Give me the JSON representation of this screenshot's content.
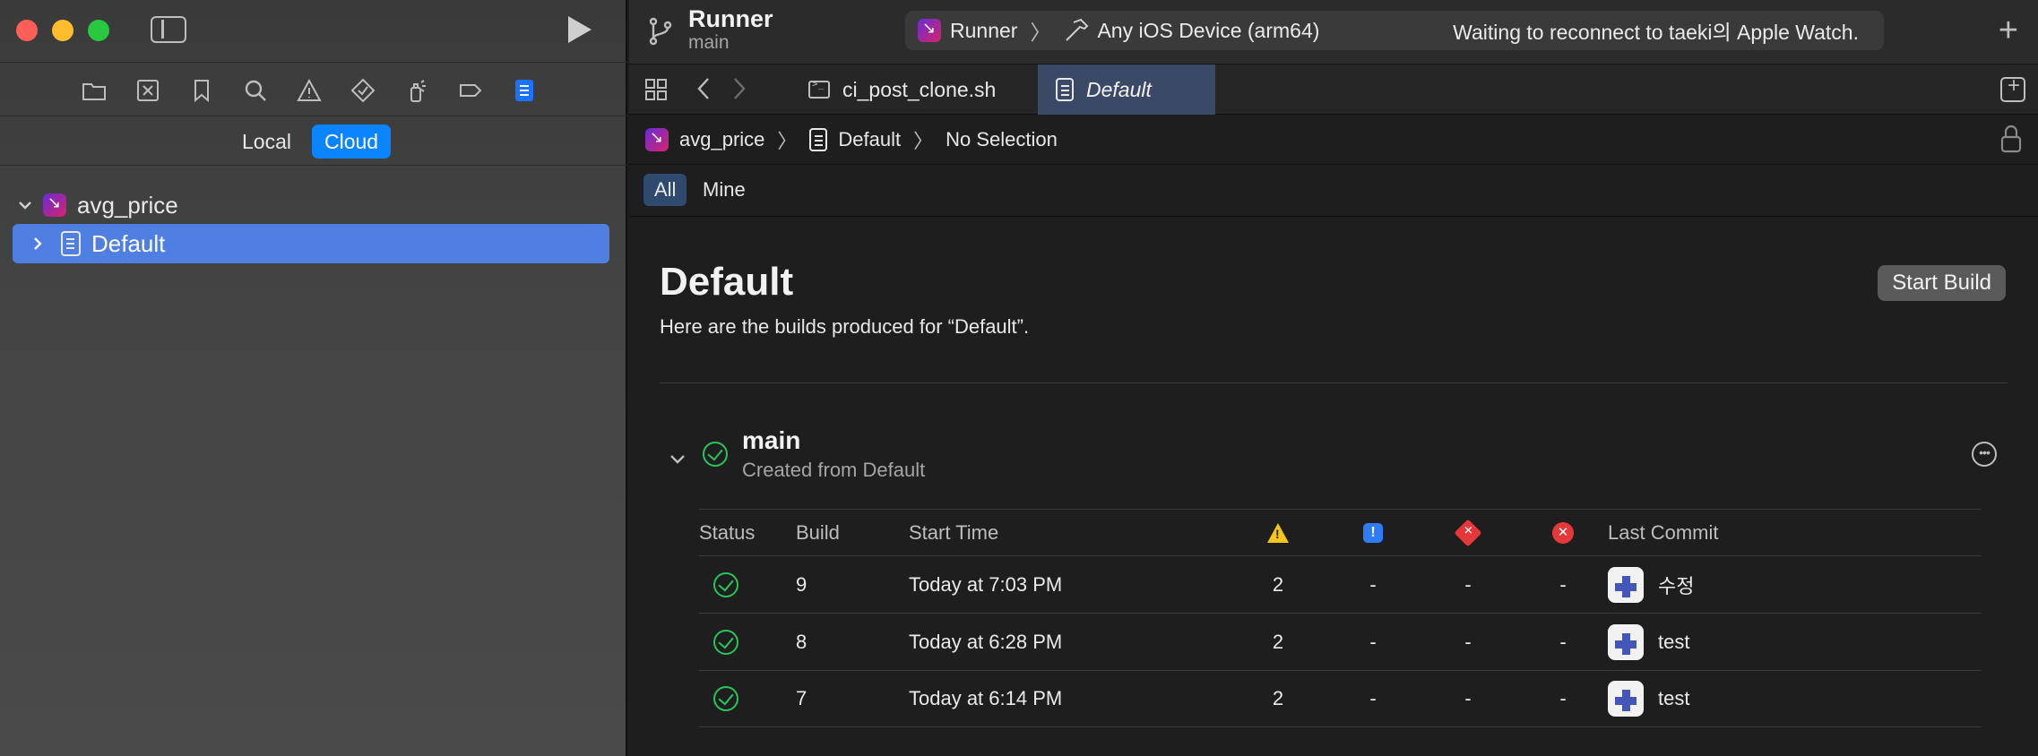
{
  "navigator": {
    "segments": {
      "local": "Local",
      "cloud": "Cloud"
    },
    "tree": [
      {
        "label": "avg_price"
      },
      {
        "label": "Default"
      }
    ]
  },
  "toolbar": {
    "scheme_title": "Runner",
    "scheme_branch": "main",
    "status_app": "Runner",
    "status_device": "Any iOS Device (arm64)",
    "status_message": "Waiting to reconnect to taeki의 Apple Watch."
  },
  "tabs": [
    {
      "label": "ci_post_clone.sh"
    },
    {
      "label": "Default"
    }
  ],
  "jumpbar": {
    "project": "avg_price",
    "workflow": "Default",
    "selection": "No Selection"
  },
  "filter": {
    "all": "All",
    "mine": "Mine"
  },
  "page": {
    "title": "Default",
    "description": "Here are the builds produced for “Default”.",
    "start_build": "Start Build"
  },
  "group": {
    "title": "main",
    "subtitle": "Created from Default"
  },
  "table": {
    "headers": {
      "status": "Status",
      "build": "Build",
      "start_time": "Start Time",
      "last_commit": "Last Commit"
    },
    "rows": [
      {
        "build": "9",
        "start_time": "Today at 7:03 PM",
        "warnings": "2",
        "issues": "-",
        "tests": "-",
        "errors": "-",
        "commit": "수정"
      },
      {
        "build": "8",
        "start_time": "Today at 6:28 PM",
        "warnings": "2",
        "issues": "-",
        "tests": "-",
        "errors": "-",
        "commit": "test"
      },
      {
        "build": "7",
        "start_time": "Today at 6:14 PM",
        "warnings": "2",
        "issues": "-",
        "tests": "-",
        "errors": "-",
        "commit": "test"
      }
    ]
  },
  "colors": {
    "accent": "#0a84ff",
    "selection": "#4f7fe0",
    "success": "#29c35b",
    "warning": "#f5c518",
    "error": "#e5383b",
    "issue": "#2f7cf6"
  }
}
